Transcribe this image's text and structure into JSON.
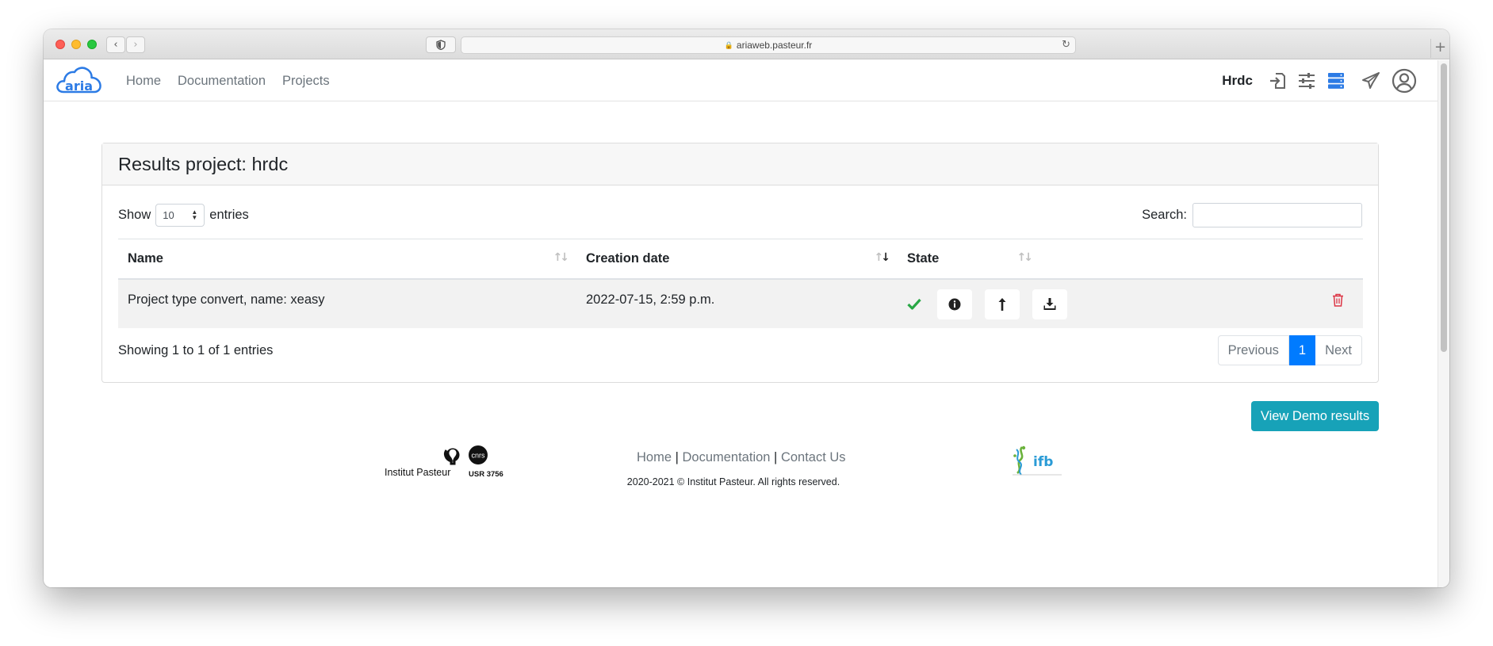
{
  "browser": {
    "url": "ariaweb.pasteur.fr"
  },
  "navbar": {
    "logo_text": "aria",
    "links": [
      "Home",
      "Documentation",
      "Projects"
    ],
    "user": "Hrdc",
    "icons": [
      "sign-in-icon",
      "sliders-icon",
      "server-icon",
      "paper-plane-icon",
      "user-circle-icon"
    ],
    "accent": "#2c7be5"
  },
  "card": {
    "title": "Results project: hrdc",
    "show_label": "Show",
    "entries_label": "entries",
    "page_size": "10",
    "search_label": "Search:",
    "search_value": "",
    "columns": [
      "Name",
      "Creation date",
      "State"
    ],
    "rows": [
      {
        "name": "Project type convert, name: xeasy",
        "creation_date": "2022-07-15, 2:59 p.m.",
        "state": "success"
      }
    ],
    "info": "Showing 1 to 1 of 1 entries",
    "pagination": {
      "previous": "Previous",
      "current": "1",
      "next": "Next"
    }
  },
  "demo_button": "View Demo results",
  "footer": {
    "links": [
      "Home",
      "Documentation",
      "Contact Us"
    ],
    "copyright": "2020-2021 © Institut Pasteur. All rights reserved.",
    "pasteur_logo_text": "Institut Pasteur",
    "cnrs_text": "cnrs",
    "usr_text": "USR 3756",
    "ifb_text": "ifb"
  },
  "colors": {
    "primary": "#007bff",
    "info": "#17a2b8",
    "success": "#28a745",
    "danger": "#dc3545"
  }
}
